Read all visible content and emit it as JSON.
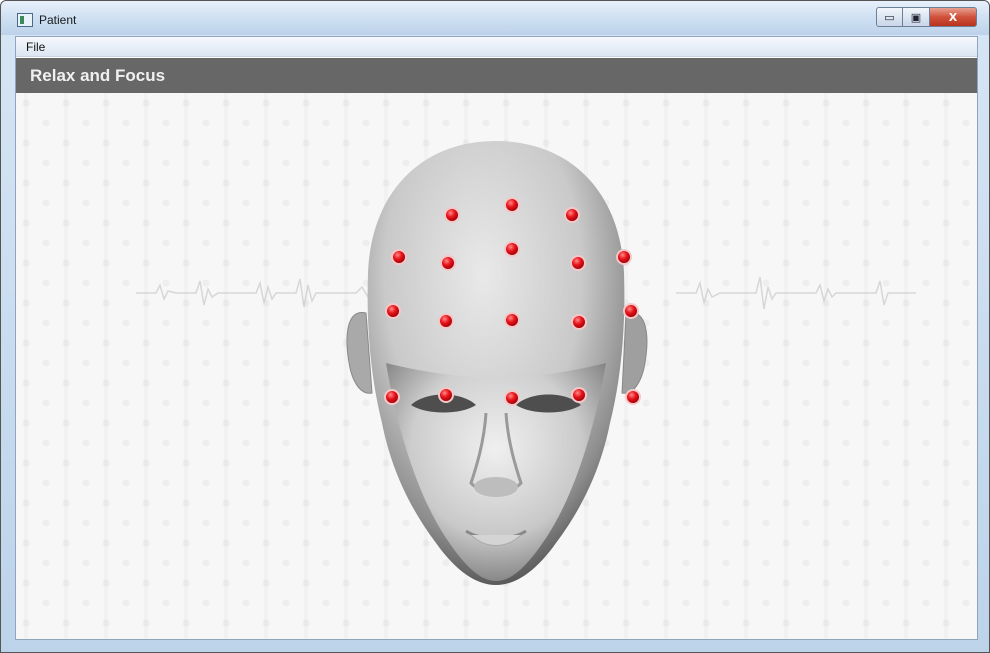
{
  "window": {
    "title": "Patient",
    "controls": {
      "minimize": "▭",
      "maximize": "▣",
      "close": "X"
    }
  },
  "menu": {
    "items": [
      {
        "label": "File"
      }
    ]
  },
  "header": {
    "title": "Relax and Focus"
  },
  "colors": {
    "header_bg": "#676767",
    "electrode": "#e8141b",
    "canvas_bg": "#f7f7f7"
  },
  "icons": [
    "app-icon",
    "minimize-icon",
    "maximize-icon",
    "close-icon"
  ],
  "scene": {
    "illustration": "3d-head-with-eeg-electrodes",
    "electrode_count": 18
  }
}
